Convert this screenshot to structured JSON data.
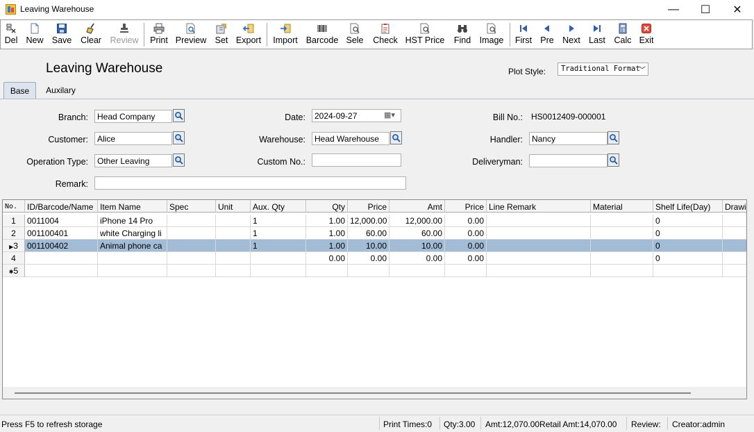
{
  "window": {
    "title": "Leaving Warehouse",
    "controls": [
      "—",
      "☐",
      "✕"
    ]
  },
  "toolbar": {
    "del": "Del",
    "new": "New",
    "save": "Save",
    "clear": "Clear",
    "review": "Review",
    "print": "Print",
    "preview": "Preview",
    "set": "Set",
    "export": "Export",
    "import": "Import",
    "barcode": "Barcode",
    "sele": "Sele",
    "check": "Check",
    "hst_price": "HST Price",
    "find": "Find",
    "image": "Image",
    "first": "First",
    "pre": "Pre",
    "next": "Next",
    "last": "Last",
    "calc": "Calc",
    "exit": "Exit"
  },
  "header": {
    "title": "Leaving Warehouse",
    "plot_style_label": "Plot Style:",
    "plot_style_value": "Traditional Format"
  },
  "tabs": {
    "base": "Base",
    "auxiliary": "Auxilary"
  },
  "form": {
    "branch_label": "Branch:",
    "branch_value": "Head Company",
    "customer_label": "Customer:",
    "customer_value": "Alice",
    "operation_type_label": "Operation Type:",
    "operation_type_value": "Other Leaving",
    "remark_label": "Remark:",
    "remark_value": "",
    "date_label": "Date:",
    "date_value": "2024-09-27",
    "warehouse_label": "Warehouse:",
    "warehouse_value": "Head Warehouse",
    "custom_no_label": "Custom No.:",
    "custom_no_value": "",
    "bill_no_label": "Bill No.:",
    "bill_no_value": "HS0012409-000001",
    "handler_label": "Handler:",
    "handler_value": "Nancy",
    "deliveryman_label": "Deliveryman:",
    "deliveryman_value": ""
  },
  "grid": {
    "headers": [
      "No.",
      "ID/Barcode/Name",
      "Item Name",
      "Spec",
      "Unit",
      "Aux. Qty",
      "Qty",
      "Price",
      "Amt",
      "Price",
      "Line Remark",
      "Material",
      "Shelf Life(Day)",
      "Drawi"
    ],
    "rows": [
      {
        "no": "1",
        "id": "0011004",
        "name": "iPhone 14 Pro",
        "spec": "",
        "unit": "",
        "aux": "1",
        "qty": "1.00",
        "price": "12,000.00",
        "amt": "12,000.00",
        "price2": "0.00",
        "remark": "",
        "material": "",
        "shelf": "0",
        "draw": ""
      },
      {
        "no": "2",
        "id": "001100401",
        "name": "white Charging li",
        "spec": "",
        "unit": "",
        "aux": "1",
        "qty": "1.00",
        "price": "60.00",
        "amt": "60.00",
        "price2": "0.00",
        "remark": "",
        "material": "",
        "shelf": "0",
        "draw": ""
      },
      {
        "no": "3",
        "id": "001100402",
        "name": "Animal phone ca",
        "spec": "",
        "unit": "",
        "aux": "1",
        "qty": "1.00",
        "price": "10.00",
        "amt": "10.00",
        "price2": "0.00",
        "remark": "",
        "material": "",
        "shelf": "0",
        "draw": ""
      },
      {
        "no": "4",
        "id": "",
        "name": "",
        "spec": "",
        "unit": "",
        "aux": "",
        "qty": "0.00",
        "price": "0.00",
        "amt": "0.00",
        "price2": "0.00",
        "remark": "",
        "material": "",
        "shelf": "0",
        "draw": ""
      },
      {
        "no": "5",
        "id": "",
        "name": "",
        "spec": "",
        "unit": "",
        "aux": "",
        "qty": "",
        "price": "",
        "amt": "",
        "price2": "",
        "remark": "",
        "material": "",
        "shelf": "",
        "draw": ""
      }
    ],
    "selected_row_index": 2
  },
  "status": {
    "hint": "Press F5 to refresh storage",
    "print_times": "Print Times:0",
    "qty": "Qty:3.00",
    "amt": "Amt:12,070.00Retail Amt:14,070.00",
    "review": "Review:",
    "creator": "Creator:admin"
  }
}
